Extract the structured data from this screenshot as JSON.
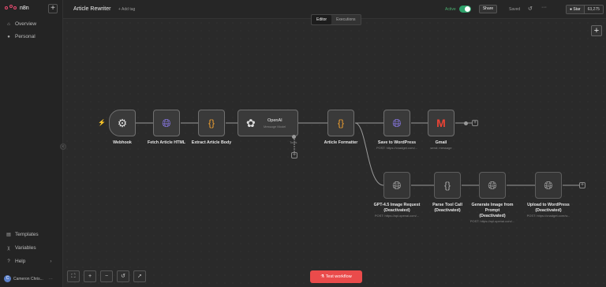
{
  "sidebar": {
    "brand": "n8n",
    "new_button": "+",
    "items": [
      {
        "label": "Overview",
        "icon": "home-icon"
      },
      {
        "label": "Personal",
        "icon": "user-icon"
      }
    ],
    "bottom_items": [
      {
        "label": "Templates",
        "icon": "templates-icon"
      },
      {
        "label": "Variables",
        "icon": "variables-icon"
      },
      {
        "label": "Help",
        "icon": "help-icon"
      }
    ],
    "user": {
      "initials": "C",
      "name": "Cameron Chris..."
    },
    "collapse": "‹"
  },
  "header": {
    "workflow_title": "Article Rewriter",
    "add_tag": "+ Add tag",
    "active_label": "Active",
    "share": "Share",
    "saved": "Saved",
    "github": {
      "label": "Star",
      "count": "63,275"
    }
  },
  "tabs": [
    {
      "label": "Editor",
      "active": true
    },
    {
      "label": "Executions",
      "active": false
    }
  ],
  "nodes": {
    "webhook": {
      "label": "Webhook"
    },
    "fetch": {
      "label": "Fetch Article HTML"
    },
    "extract": {
      "label": "Extract Article Body"
    },
    "openai": {
      "label": "OpenAI",
      "sub": "Message Model",
      "tool": "Tools"
    },
    "formatter": {
      "label": "Article Formatter"
    },
    "save_wp": {
      "label": "Save to WordPress",
      "sub": "POST: https://cnadget.com/..."
    },
    "gmail": {
      "label": "Gmail",
      "sub": "send: message"
    },
    "gpt_image": {
      "label": "GPT-4.5 Image Request",
      "label2": "(Deactivated)",
      "sub": "POST: https://api.openai.com/..."
    },
    "parse_tool": {
      "label": "Parse Tool Call",
      "label2": "(Deactivated)"
    },
    "gen_image": {
      "label": "Generate Image from",
      "label2": "Prompt",
      "label3": "(Deactivated)",
      "sub": "POST: https://api.openai.com/..."
    },
    "upload_wp": {
      "label": "Upload to WordPress",
      "label2": "(Deactivated)",
      "sub": "POST: https://cnadget.com/w..."
    }
  },
  "canvas": {
    "add_node": "+"
  },
  "toolbar": {
    "fit": "⛶",
    "zoom_in": "+",
    "zoom_out": "−",
    "reset": "↺",
    "select": "➚"
  },
  "test_workflow": "Test workflow",
  "colors": {
    "accent": "#ea4b4b",
    "active": "#2ea26b",
    "code": "#f0a030",
    "globe": "#8e7cf0"
  }
}
